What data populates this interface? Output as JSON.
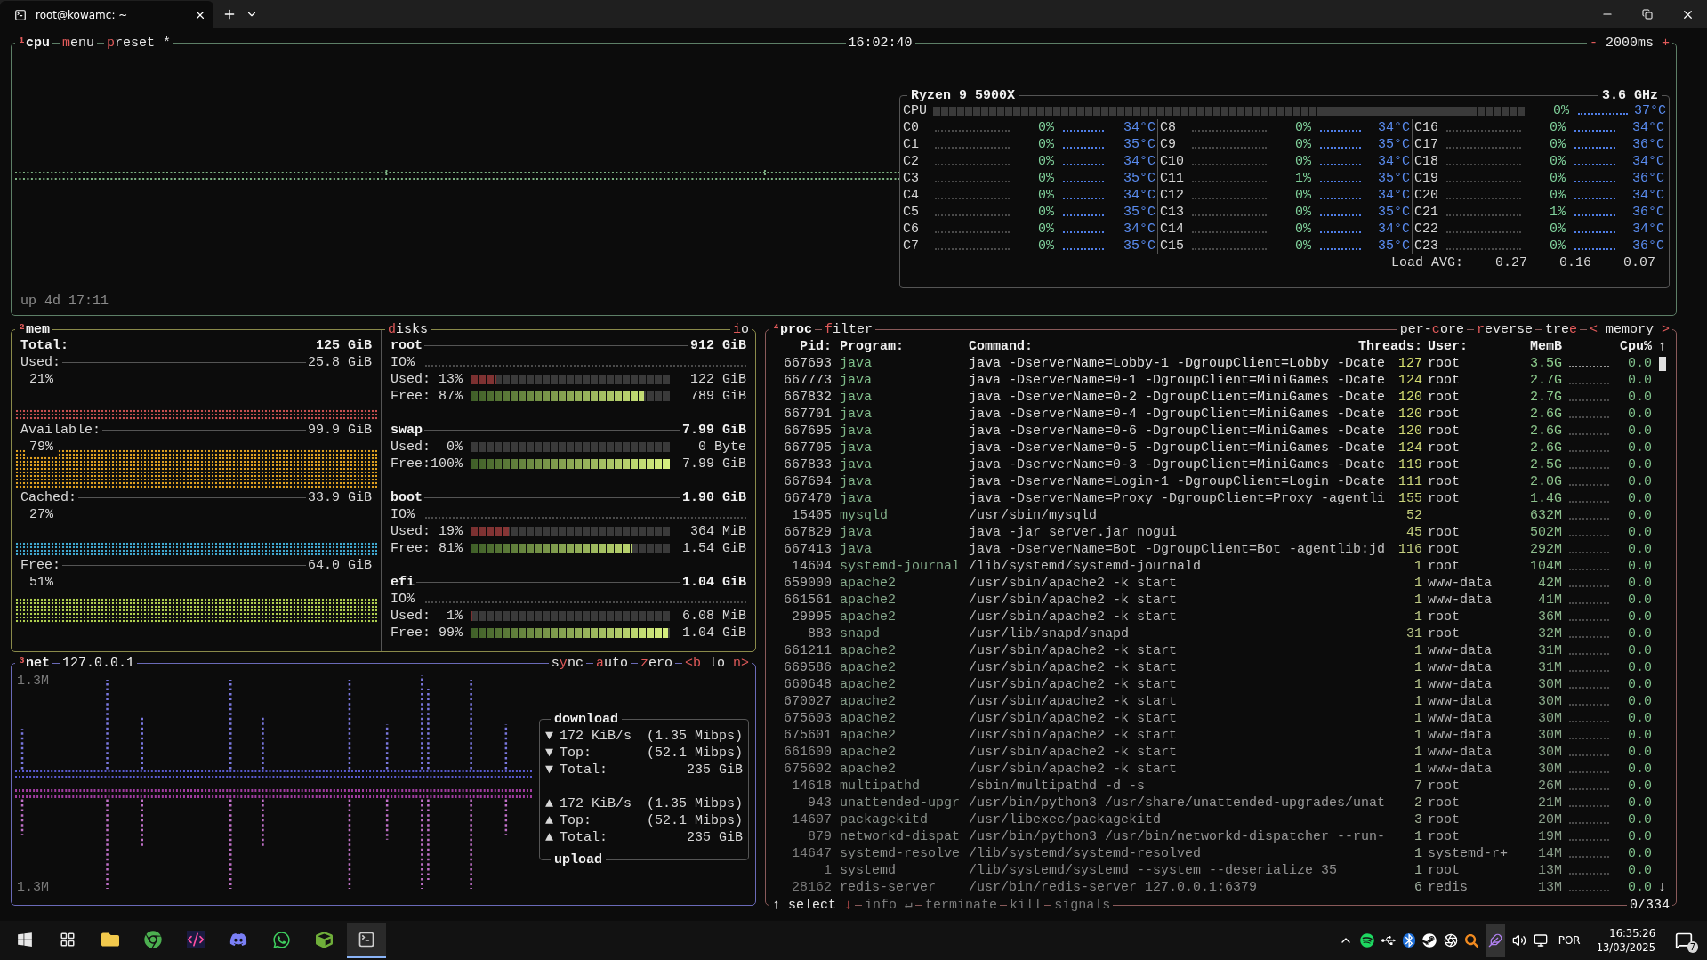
{
  "tab": {
    "title": "root@kowamc: ~"
  },
  "cpu": {
    "header": {
      "left": [
        {
          "kind": "title",
          "parts": [
            {
              "t": "¹",
              "hot": true
            },
            {
              "t": "cpu",
              "hot": false
            }
          ]
        },
        {
          "kind": "option",
          "parts": [
            {
              "t": "m",
              "hot": true
            },
            {
              "t": "enu",
              "hot": false
            }
          ]
        },
        {
          "kind": "option",
          "parts": [
            {
              "t": "p",
              "hot": true
            },
            {
              "t": "reset *",
              "hot": false
            }
          ]
        }
      ],
      "center": [
        {
          "kind": "text",
          "parts": [
            {
              "t": "16:02:40",
              "hot": false
            }
          ]
        }
      ],
      "right": [
        {
          "kind": "option",
          "parts": [
            {
              "t": "- ",
              "hot": true
            },
            {
              "t": "2000ms",
              "hot": false
            },
            {
              "t": " +",
              "hot": true
            }
          ]
        }
      ]
    },
    "uptime": "up 4d 17:11",
    "model": "Ryzen 9 5900X",
    "freq": "3.6 GHz",
    "total": {
      "label": "CPU",
      "pct": "0%",
      "temp": "37°C"
    },
    "cores": [
      {
        "name": "C0",
        "pct": "0%",
        "temp": "34°C"
      },
      {
        "name": "C1",
        "pct": "0%",
        "temp": "35°C"
      },
      {
        "name": "C2",
        "pct": "0%",
        "temp": "34°C"
      },
      {
        "name": "C3",
        "pct": "0%",
        "temp": "35°C"
      },
      {
        "name": "C4",
        "pct": "0%",
        "temp": "34°C"
      },
      {
        "name": "C5",
        "pct": "0%",
        "temp": "35°C"
      },
      {
        "name": "C6",
        "pct": "0%",
        "temp": "34°C"
      },
      {
        "name": "C7",
        "pct": "0%",
        "temp": "35°C"
      },
      {
        "name": "C8",
        "pct": "0%",
        "temp": "34°C"
      },
      {
        "name": "C9",
        "pct": "0%",
        "temp": "35°C"
      },
      {
        "name": "C10",
        "pct": "0%",
        "temp": "34°C"
      },
      {
        "name": "C11",
        "pct": "1%",
        "temp": "35°C"
      },
      {
        "name": "C12",
        "pct": "0%",
        "temp": "34°C"
      },
      {
        "name": "C13",
        "pct": "0%",
        "temp": "35°C"
      },
      {
        "name": "C14",
        "pct": "0%",
        "temp": "34°C"
      },
      {
        "name": "C15",
        "pct": "0%",
        "temp": "35°C"
      },
      {
        "name": "C16",
        "pct": "0%",
        "temp": "34°C"
      },
      {
        "name": "C17",
        "pct": "0%",
        "temp": "36°C"
      },
      {
        "name": "C18",
        "pct": "0%",
        "temp": "34°C"
      },
      {
        "name": "C19",
        "pct": "0%",
        "temp": "36°C"
      },
      {
        "name": "C20",
        "pct": "0%",
        "temp": "34°C"
      },
      {
        "name": "C21",
        "pct": "1%",
        "temp": "36°C"
      },
      {
        "name": "C22",
        "pct": "0%",
        "temp": "34°C"
      },
      {
        "name": "C23",
        "pct": "0%",
        "temp": "36°C"
      }
    ],
    "load": {
      "label": "Load AVG:",
      "values": [
        "0.27",
        "0.16",
        "0.07"
      ]
    }
  },
  "mem": {
    "header": {
      "left": [
        {
          "kind": "title",
          "parts": [
            {
              "t": "²",
              "hot": true
            },
            {
              "t": "mem",
              "hot": false
            }
          ]
        }
      ]
    },
    "total_label": "Total:",
    "total": "125 GiB",
    "items": [
      {
        "label": "Used:",
        "value": "25.8 GiB",
        "pct": "21%",
        "color": "#c85050"
      },
      {
        "label": "Available:",
        "value": "99.9 GiB",
        "pct": "79%",
        "color": "#e0a020"
      },
      {
        "label": "Cached:",
        "value": "33.9 GiB",
        "pct": "27%",
        "color": "#40a8d0"
      },
      {
        "label": "Free:",
        "value": "64.0 GiB",
        "pct": "51%",
        "color": "#b0d050"
      }
    ]
  },
  "disks": {
    "header": {
      "left": [
        {
          "kind": "option",
          "parts": [
            {
              "t": "d",
              "hot": true
            },
            {
              "t": "isks",
              "hot": false
            }
          ]
        }
      ],
      "right": [
        {
          "kind": "option",
          "parts": [
            {
              "t": "i",
              "hot": true
            },
            {
              "t": "o",
              "hot": false
            }
          ]
        }
      ]
    },
    "items": [
      {
        "name": "root",
        "size": "912 GiB",
        "io_label": "IO%",
        "used": {
          "label": "Used:",
          "pct": "13%",
          "level": 0.13,
          "value": "122 GiB"
        },
        "free": {
          "label": "Free:",
          "pct": "87%",
          "level": 0.87,
          "value": "789 GiB"
        }
      },
      {
        "name": "swap",
        "size": "7.99 GiB",
        "used": {
          "label": "Used:",
          "pct": "0%",
          "value": "0 Byte"
        },
        "free": {
          "label": "Free:",
          "pct": "100%",
          "level": 1,
          "value": "7.99 GiB"
        }
      },
      {
        "name": "boot",
        "size": "1.90 GiB",
        "io_label": "IO%",
        "used": {
          "label": "Used:",
          "pct": "19%",
          "level": 0.19,
          "value": "364 MiB"
        },
        "free": {
          "label": "Free:",
          "pct": "81%",
          "level": 0.81,
          "value": "1.54 GiB"
        }
      },
      {
        "name": "efi",
        "size": "1.04 GiB",
        "io_label": "IO%",
        "used": {
          "label": "Used:",
          "pct": "1%",
          "level": 0.01,
          "value": "6.08 MiB"
        },
        "free": {
          "label": "Free:",
          "pct": "99%",
          "level": 0.99,
          "value": "1.04 GiB"
        }
      }
    ]
  },
  "net": {
    "header": {
      "left": [
        {
          "kind": "title",
          "parts": [
            {
              "t": "³",
              "hot": true
            },
            {
              "t": "net",
              "hot": false
            }
          ]
        },
        {
          "kind": "text",
          "parts": [
            {
              "t": "127.0.0.1",
              "hot": false
            }
          ]
        }
      ],
      "right": [
        {
          "kind": "option",
          "parts": [
            {
              "t": "s",
              "hot": false
            },
            {
              "t": "y",
              "hot": true
            },
            {
              "t": "nc",
              "hot": false
            }
          ]
        },
        {
          "kind": "option",
          "parts": [
            {
              "t": "a",
              "hot": true
            },
            {
              "t": "uto",
              "hot": false
            }
          ]
        },
        {
          "kind": "option",
          "parts": [
            {
              "t": "z",
              "hot": true
            },
            {
              "t": "ero",
              "hot": false
            }
          ]
        },
        {
          "kind": "option",
          "parts": [
            {
              "t": "<b",
              "hot": true
            },
            {
              "t": " lo ",
              "hot": false
            },
            {
              "t": "n>",
              "hot": true
            }
          ]
        }
      ]
    },
    "scale_top": "1.3M",
    "scale_bottom": "1.3M",
    "download_title": "download",
    "upload_title": "upload",
    "download": [
      {
        "arrow": "▼",
        "label": "172 KiB/s",
        "value": "(1.35 Mibps)"
      },
      {
        "arrow": "▼",
        "label": "Top:",
        "value": "(52.1 Mibps)"
      },
      {
        "arrow": "▼",
        "label": "Total:",
        "value": "235 GiB"
      }
    ],
    "upload": [
      {
        "arrow": "▲",
        "label": "172 KiB/s",
        "value": "(1.35 Mibps)"
      },
      {
        "arrow": "▲",
        "label": "Top:",
        "value": "(52.1 Mibps)"
      },
      {
        "arrow": "▲",
        "label": "Total:",
        "value": "235 GiB"
      }
    ]
  },
  "proc": {
    "header": {
      "left": [
        {
          "kind": "title",
          "parts": [
            {
              "t": "⁴",
              "hot": true
            },
            {
              "t": "proc",
              "hot": false
            }
          ]
        },
        {
          "kind": "option",
          "parts": [
            {
              "t": "f",
              "hot": true
            },
            {
              "t": "ilter",
              "hot": false
            }
          ]
        }
      ],
      "right": [
        {
          "kind": "option",
          "parts": [
            {
              "t": "per-",
              "hot": false
            },
            {
              "t": "c",
              "hot": true
            },
            {
              "t": "ore",
              "hot": false
            }
          ]
        },
        {
          "kind": "option",
          "parts": [
            {
              "t": "r",
              "hot": true
            },
            {
              "t": "everse",
              "hot": false
            }
          ]
        },
        {
          "kind": "option",
          "parts": [
            {
              "t": "tre",
              "hot": false
            },
            {
              "t": "e",
              "hot": true
            }
          ]
        },
        {
          "kind": "option",
          "parts": [
            {
              "t": "<",
              "hot": true
            },
            {
              "t": " memory ",
              "hot": false
            },
            {
              "t": ">",
              "hot": true
            }
          ]
        }
      ]
    },
    "footer": {
      "left": [
        {
          "kind": "option",
          "disabled": false,
          "parts": [
            {
              "t": "↑ ",
              "hot": false
            },
            {
              "t": "select",
              "hot": false
            },
            {
              "t": " ↓",
              "hot": true
            }
          ]
        },
        {
          "kind": "option",
          "disabled": true,
          "parts": [
            {
              "t": "info ↵",
              "hot": false
            }
          ]
        },
        {
          "kind": "option",
          "disabled": true,
          "parts": [
            {
              "t": "terminate",
              "hot": false
            }
          ]
        },
        {
          "kind": "option",
          "disabled": true,
          "parts": [
            {
              "t": "kill",
              "hot": false
            }
          ]
        },
        {
          "kind": "option",
          "disabled": true,
          "parts": [
            {
              "t": "signals",
              "hot": false
            }
          ]
        }
      ],
      "right": [
        {
          "kind": "text",
          "parts": [
            {
              "t": "0/334",
              "hot": false
            }
          ]
        }
      ]
    },
    "columns": [
      "Pid:",
      "Program:",
      "Command:",
      "Threads:",
      "User:",
      "MemB",
      "Cpu%"
    ],
    "scroll_up": "↑",
    "scroll_down": "↓",
    "rows": [
      [
        "667693",
        "java",
        "java -DserverName=Lobby-1 -DgroupClient=Lobby -Dcate",
        "127",
        "root",
        "3.5G",
        "0.0"
      ],
      [
        "667773",
        "java",
        "java -DserverName=0-1 -DgroupClient=MiniGames -Dcate",
        "124",
        "root",
        "2.7G",
        "0.0"
      ],
      [
        "667832",
        "java",
        "java -DserverName=0-2 -DgroupClient=MiniGames -Dcate",
        "120",
        "root",
        "2.7G",
        "0.0"
      ],
      [
        "667701",
        "java",
        "java -DserverName=0-4 -DgroupClient=MiniGames -Dcate",
        "120",
        "root",
        "2.6G",
        "0.0"
      ],
      [
        "667695",
        "java",
        "java -DserverName=0-6 -DgroupClient=MiniGames -Dcate",
        "120",
        "root",
        "2.6G",
        "0.0"
      ],
      [
        "667705",
        "java",
        "java -DserverName=0-5 -DgroupClient=MiniGames -Dcate",
        "124",
        "root",
        "2.6G",
        "0.0"
      ],
      [
        "667833",
        "java",
        "java -DserverName=0-3 -DgroupClient=MiniGames -Dcate",
        "119",
        "root",
        "2.5G",
        "0.0"
      ],
      [
        "667694",
        "java",
        "java -DserverName=Login-1 -DgroupClient=Login -Dcate",
        "111",
        "root",
        "2.0G",
        "0.0"
      ],
      [
        "667470",
        "java",
        "java -DserverName=Proxy -DgroupClient=Proxy -agentli",
        "155",
        "root",
        "1.4G",
        "0.0"
      ],
      [
        "15405",
        "mysqld",
        "/usr/sbin/mysqld",
        "52",
        null,
        "632M",
        "0.0"
      ],
      [
        "667829",
        "java",
        "java -jar server.jar nogui",
        "45",
        "root",
        "502M",
        "0.0"
      ],
      [
        "667413",
        "java",
        "java -DserverName=Bot -DgroupClient=Bot -agentlib:jd",
        "116",
        "root",
        "292M",
        "0.0"
      ],
      [
        "14604",
        "systemd-journal",
        "/lib/systemd/systemd-journald",
        "1",
        "root",
        "104M",
        "0.0"
      ],
      [
        "659000",
        "apache2",
        "/usr/sbin/apache2 -k start",
        "1",
        "www-data",
        "42M",
        "0.0"
      ],
      [
        "661561",
        "apache2",
        "/usr/sbin/apache2 -k start",
        "1",
        "www-data",
        "41M",
        "0.0"
      ],
      [
        "29995",
        "apache2",
        "/usr/sbin/apache2 -k start",
        "1",
        "root",
        "36M",
        "0.0"
      ],
      [
        "883",
        "snapd",
        "/usr/lib/snapd/snapd",
        "31",
        "root",
        "32M",
        "0.0"
      ],
      [
        "661211",
        "apache2",
        "/usr/sbin/apache2 -k start",
        "1",
        "www-data",
        "31M",
        "0.0"
      ],
      [
        "669586",
        "apache2",
        "/usr/sbin/apache2 -k start",
        "1",
        "www-data",
        "31M",
        "0.0"
      ],
      [
        "660648",
        "apache2",
        "/usr/sbin/apache2 -k start",
        "1",
        "www-data",
        "30M",
        "0.0"
      ],
      [
        "670027",
        "apache2",
        "/usr/sbin/apache2 -k start",
        "1",
        "www-data",
        "30M",
        "0.0"
      ],
      [
        "675603",
        "apache2",
        "/usr/sbin/apache2 -k start",
        "1",
        "www-data",
        "30M",
        "0.0"
      ],
      [
        "675601",
        "apache2",
        "/usr/sbin/apache2 -k start",
        "1",
        "www-data",
        "30M",
        "0.0"
      ],
      [
        "661600",
        "apache2",
        "/usr/sbin/apache2 -k start",
        "1",
        "www-data",
        "30M",
        "0.0"
      ],
      [
        "675602",
        "apache2",
        "/usr/sbin/apache2 -k start",
        "1",
        "www-data",
        "30M",
        "0.0"
      ],
      [
        "14618",
        "multipathd",
        "/sbin/multipathd -d -s",
        "7",
        "root",
        "26M",
        "0.0"
      ],
      [
        "943",
        "unattended-upgr",
        "/usr/bin/python3 /usr/share/unattended-upgrades/unat",
        "2",
        "root",
        "21M",
        "0.0"
      ],
      [
        "14607",
        "packagekitd",
        "/usr/libexec/packagekitd",
        "3",
        "root",
        "20M",
        "0.0"
      ],
      [
        "879",
        "networkd-dispat",
        "/usr/bin/python3 /usr/bin/networkd-dispatcher --run-",
        "1",
        "root",
        "19M",
        "0.0"
      ],
      [
        "14647",
        "systemd-resolve",
        "/lib/systemd/systemd-resolved",
        "1",
        "systemd-r+",
        "14M",
        "0.0"
      ],
      [
        "1",
        "systemd",
        "/lib/systemd/systemd --system --deserialize 35",
        "1",
        "root",
        "13M",
        "0.0"
      ],
      [
        "28162",
        "redis-server",
        "/usr/bin/redis-server 127.0.0.1:6379",
        "6",
        "redis",
        "13M",
        "0.0"
      ]
    ]
  },
  "taskbar": {
    "apps": [
      {
        "kind": "start",
        "selected": false
      },
      {
        "kind": "taskview",
        "selected": false
      },
      {
        "kind": "folder",
        "selected": false
      },
      {
        "kind": "browser",
        "selected": false
      },
      {
        "kind": "ide",
        "selected": false
      },
      {
        "kind": "chat",
        "selected": false
      },
      {
        "kind": "phone",
        "selected": false
      },
      {
        "kind": "cube",
        "selected": false
      },
      {
        "kind": "terminal",
        "selected": true
      }
    ],
    "language": "POR",
    "time": "16:35:26",
    "date": "13/03/2025",
    "notifications": "7"
  }
}
